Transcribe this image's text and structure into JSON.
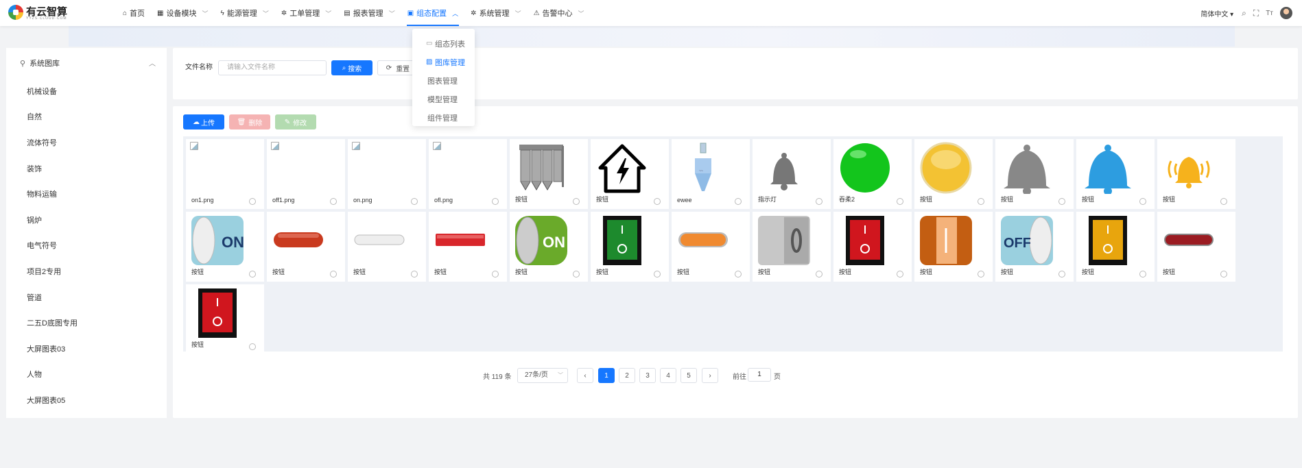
{
  "brand": {
    "name": "有云智算",
    "sub": "YYZS·CLOUD·COM"
  },
  "nav": [
    {
      "label": "首页",
      "icon": "home-icon",
      "glyph": "⌂",
      "chev": false,
      "active": false
    },
    {
      "label": "设备模块",
      "icon": "grid-icon",
      "glyph": "▦",
      "chev": true,
      "active": false
    },
    {
      "label": "能源管理",
      "icon": "bolt-icon",
      "glyph": "ϟ",
      "chev": true,
      "active": false
    },
    {
      "label": "工单管理",
      "icon": "gear-icon",
      "glyph": "✲",
      "chev": true,
      "active": false
    },
    {
      "label": "报表管理",
      "icon": "report-icon",
      "glyph": "▤",
      "chev": true,
      "active": false
    },
    {
      "label": "组态配置",
      "icon": "config-icon",
      "glyph": "▣",
      "chev": true,
      "active": true
    },
    {
      "label": "系统管理",
      "icon": "settings-icon",
      "glyph": "✲",
      "chev": true,
      "active": false
    },
    {
      "label": "告警中心",
      "icon": "alarm-icon",
      "glyph": "⚠",
      "chev": true,
      "active": false
    }
  ],
  "topbar": {
    "lang": "简体中文",
    "lang_chev": "▾"
  },
  "dropdown": [
    {
      "label": "组态列表",
      "glyph": "▭",
      "active": false,
      "plain": false
    },
    {
      "label": "图库管理",
      "glyph": "▨",
      "active": true,
      "plain": false
    },
    {
      "label": "图表管理",
      "glyph": "",
      "active": false,
      "plain": true
    },
    {
      "label": "模型管理",
      "glyph": "",
      "active": false,
      "plain": true
    },
    {
      "label": "组件管理",
      "glyph": "",
      "active": false,
      "plain": true
    }
  ],
  "sidebar": {
    "title": "系统图库",
    "items": [
      "机械设备",
      "自然",
      "流体符号",
      "装饰",
      "物料运输",
      "锅炉",
      "电气符号",
      "项目2专用",
      "管道",
      "二五D底图专用",
      "大屏图表03",
      "人物",
      "大屏图表05"
    ]
  },
  "search": {
    "label": "文件名称",
    "placeholder": "请输入文件名称",
    "search_label": "搜索",
    "reset_label": "重置"
  },
  "toolbar": {
    "upload": "上传",
    "delete": "删除",
    "edit": "修改"
  },
  "tiles": [
    {
      "name": "on1.png",
      "img": "broken"
    },
    {
      "name": "off1.png",
      "img": "broken"
    },
    {
      "name": "on.png",
      "img": "broken"
    },
    {
      "name": "ofl.png",
      "img": "broken"
    },
    {
      "name": "按钮",
      "img": "silo"
    },
    {
      "name": "按钮",
      "img": "house-bolt"
    },
    {
      "name": "ewee",
      "img": "hopper"
    },
    {
      "name": "指示灯",
      "img": "bell-gray-small"
    },
    {
      "name": "吞柔2",
      "img": "green-light"
    },
    {
      "name": "按钮",
      "img": "yellow-light"
    },
    {
      "name": "按钮",
      "img": "bell-gray"
    },
    {
      "name": "按钮",
      "img": "bell-blue"
    },
    {
      "name": "按钮",
      "img": "bell-orange-ring"
    },
    {
      "name": "按钮",
      "img": "switch-on-blue"
    },
    {
      "name": "按钮",
      "img": "pill-red"
    },
    {
      "name": "按钮",
      "img": "pill-white"
    },
    {
      "name": "按钮",
      "img": "bar-red"
    },
    {
      "name": "按钮",
      "img": "switch-on-green"
    },
    {
      "name": "按钮",
      "img": "rocker-green"
    },
    {
      "name": "按钮",
      "img": "pill-orange"
    },
    {
      "name": "按钮",
      "img": "switch-off-gray"
    },
    {
      "name": "按钮",
      "img": "rocker-red"
    },
    {
      "name": "按钮",
      "img": "switch-orange"
    },
    {
      "name": "按钮",
      "img": "switch-off-blue"
    },
    {
      "name": "按钮",
      "img": "rocker-yellow"
    },
    {
      "name": "按钮",
      "img": "pill-darkred"
    },
    {
      "name": "按钮",
      "img": "rocker-red"
    }
  ],
  "pager": {
    "total": "共 119 条",
    "size": "27条/页",
    "pages": [
      "1",
      "2",
      "3",
      "4",
      "5"
    ],
    "current": "1",
    "prev": "‹",
    "next": "›",
    "goto": "前往",
    "goto_value": "1",
    "unit": "页"
  }
}
